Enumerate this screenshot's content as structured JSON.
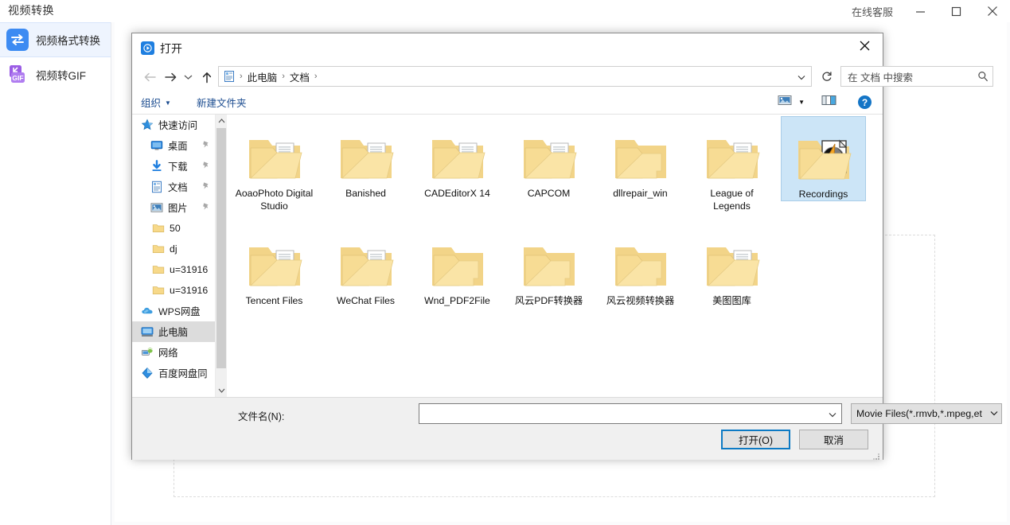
{
  "app": {
    "title": "视频转换",
    "titlebar": {
      "support_label": "在线客服",
      "minimize": "minimize",
      "maximize": "maximize",
      "close": "close"
    },
    "nav": [
      {
        "label": "视频格式转换",
        "icon": "swap-arrows-icon",
        "active": true
      },
      {
        "label": "视频转GIF",
        "icon": "gif-icon",
        "active": false
      }
    ],
    "accent_color": "#3d8bf2",
    "active_nav_bg": "#eef4fe"
  },
  "dialog": {
    "title": "打开",
    "app_icon": "media-player-icon",
    "close_label": "×",
    "nav": {
      "back": "back-arrow",
      "forward": "forward-arrow",
      "recent": "recent-locations-chevron",
      "up": "up-arrow"
    },
    "address": {
      "icon": "documents-icon",
      "crumbs": [
        "此电脑",
        "文档"
      ],
      "separator": "›",
      "dropdown": "⌄"
    },
    "refresh": "⟳",
    "search": {
      "placeholder": "在 文档 中搜索",
      "value": "",
      "icon": "search-icon"
    },
    "commandbar": {
      "organize": "组织",
      "organize_caret": "▼",
      "new_folder": "新建文件夹",
      "view_icon": "view-thumbnails-icon",
      "view_caret": "▼",
      "preview_pane_icon": "preview-pane-icon",
      "help_icon": "?"
    },
    "tree": [
      {
        "label": "快速访问",
        "icon": "star-icon",
        "indent": 0,
        "pinned": false,
        "selected": false
      },
      {
        "label": "桌面",
        "icon": "desktop-icon",
        "indent": 1,
        "pinned": true,
        "selected": false
      },
      {
        "label": "下载",
        "icon": "download-icon",
        "indent": 1,
        "pinned": true,
        "selected": false
      },
      {
        "label": "文档",
        "icon": "documents-icon",
        "indent": 1,
        "pinned": true,
        "selected": false
      },
      {
        "label": "图片",
        "icon": "pictures-icon",
        "indent": 1,
        "pinned": true,
        "selected": false
      },
      {
        "label": "50",
        "icon": "folder-icon",
        "indent": 2,
        "pinned": false,
        "selected": false
      },
      {
        "label": "dj",
        "icon": "folder-icon",
        "indent": 2,
        "pinned": false,
        "selected": false
      },
      {
        "label": "u=31916",
        "icon": "folder-icon",
        "indent": 2,
        "pinned": false,
        "selected": false
      },
      {
        "label": "u=31916",
        "icon": "folder-icon",
        "indent": 2,
        "pinned": false,
        "selected": false
      },
      {
        "label": "WPS网盘",
        "icon": "cloud-icon",
        "indent": 0,
        "pinned": false,
        "selected": false
      },
      {
        "label": "此电脑",
        "icon": "computer-icon",
        "indent": 0,
        "pinned": false,
        "selected": true
      },
      {
        "label": "网络",
        "icon": "network-icon",
        "indent": 0,
        "pinned": false,
        "selected": false
      },
      {
        "label": "百度网盘同",
        "icon": "baidu-netdisk-icon",
        "indent": 0,
        "pinned": false,
        "selected": false
      }
    ],
    "tree_scrollbar": {
      "up": "⌃",
      "down": "⌄"
    },
    "files": [
      {
        "name": "AoaoPhoto Digital Studio",
        "icon": "folder-with-files-icon",
        "selected": false
      },
      {
        "name": "Banished",
        "icon": "folder-with-files-icon",
        "selected": false
      },
      {
        "name": "CADEditorX 14",
        "icon": "folder-with-files-icon",
        "selected": false
      },
      {
        "name": "CAPCOM",
        "icon": "folder-with-files-icon",
        "selected": false
      },
      {
        "name": "dllrepair_win",
        "icon": "folder-empty-icon",
        "selected": false
      },
      {
        "name": "League of Legends",
        "icon": "folder-with-files-icon",
        "selected": false
      },
      {
        "name": "Recordings",
        "icon": "folder-media-icon",
        "selected": true
      },
      {
        "name": "Tencent Files",
        "icon": "folder-with-files-icon",
        "selected": false
      },
      {
        "name": "WeChat Files",
        "icon": "folder-with-files-icon",
        "selected": false
      },
      {
        "name": "Wnd_PDF2File",
        "icon": "folder-empty-icon",
        "selected": false
      },
      {
        "name": "风云PDF转换器",
        "icon": "folder-empty-icon",
        "selected": false
      },
      {
        "name": "风云视频转换器",
        "icon": "folder-empty-icon",
        "selected": false
      },
      {
        "name": "美图图库",
        "icon": "folder-with-files-icon",
        "selected": false
      }
    ],
    "footer": {
      "filename_label": "文件名(N):",
      "filename_value": "",
      "filename_dropdown": "⌄",
      "filter_value": "Movie Files(*.rmvb,*.mpeg,et",
      "filter_caret": "⌄",
      "open_button": "打开(O)",
      "cancel_button": "取消"
    }
  }
}
